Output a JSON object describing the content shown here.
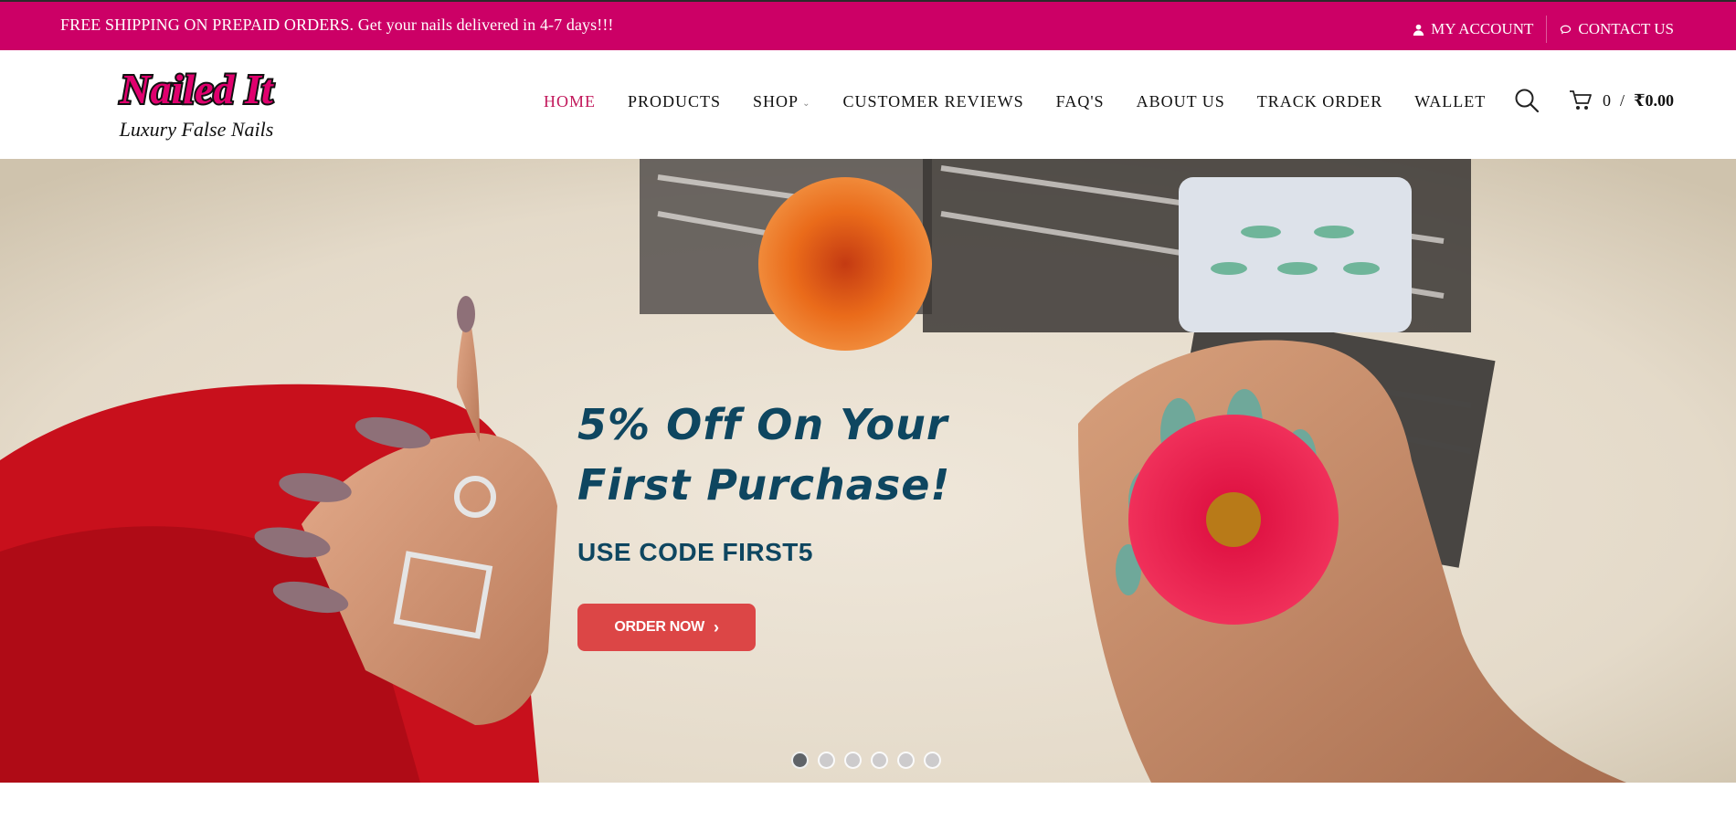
{
  "topbar": {
    "promo": "FREE SHIPPING ON PREPAID ORDERS. Get your nails delivered in 4-7 days!!!",
    "my_account": "MY ACCOUNT",
    "contact_us": "CONTACT US",
    "color": "#cc0066"
  },
  "logo": {
    "title": "Nailed It",
    "tagline": "Luxury False Nails"
  },
  "nav": {
    "items": [
      {
        "label": "HOME",
        "active": true
      },
      {
        "label": "PRODUCTS"
      },
      {
        "label": "SHOP",
        "has_dropdown": true
      },
      {
        "label": "CUSTOMER REVIEWS"
      },
      {
        "label": "FAQ'S"
      },
      {
        "label": "ABOUT US"
      },
      {
        "label": "TRACK ORDER"
      },
      {
        "label": "WALLET"
      }
    ],
    "active_color": "#c2185b"
  },
  "cart": {
    "count": "0",
    "separator": "/",
    "amount": "₹0.00"
  },
  "hero": {
    "title_line1": "5% Off On Your",
    "title_line2": "First Purchase!",
    "subtitle": "USE CODE FIRST5",
    "button_label": "ORDER NOW",
    "slide_count": 6,
    "active_slide": 1,
    "text_color": "#0e4660",
    "button_color": "#dc4646"
  },
  "icons": {
    "account": "user-icon",
    "contact": "chat-icon",
    "search": "search-icon",
    "cart": "cart-icon",
    "button_arrow": "chevron-right-icon",
    "dropdown": "chevron-down-icon"
  }
}
